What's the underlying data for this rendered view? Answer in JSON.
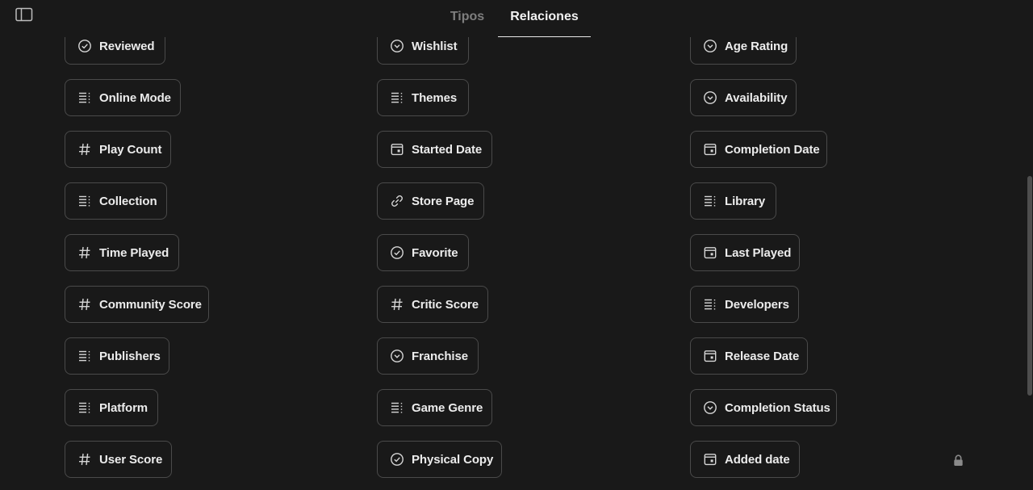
{
  "tabs": [
    {
      "label": "Tipos",
      "active": false
    },
    {
      "label": "Relaciones",
      "active": true
    }
  ],
  "columns": [
    [
      {
        "label": "Reviewed",
        "icon": "circle-check-icon"
      },
      {
        "label": "Online Mode",
        "icon": "list-icon"
      },
      {
        "label": "Play Count",
        "icon": "hash-icon"
      },
      {
        "label": "Collection",
        "icon": "list-icon"
      },
      {
        "label": "Time Played",
        "icon": "hash-icon"
      },
      {
        "label": "Community Score",
        "icon": "hash-icon"
      },
      {
        "label": "Publishers",
        "icon": "list-icon"
      },
      {
        "label": "Platform",
        "icon": "list-icon"
      },
      {
        "label": "User Score",
        "icon": "hash-icon"
      }
    ],
    [
      {
        "label": "Wishlist",
        "icon": "circle-chevron-down-icon"
      },
      {
        "label": "Themes",
        "icon": "list-icon"
      },
      {
        "label": "Started Date",
        "icon": "calendar-icon"
      },
      {
        "label": "Store Page",
        "icon": "link-icon"
      },
      {
        "label": "Favorite",
        "icon": "circle-check-icon"
      },
      {
        "label": "Critic Score",
        "icon": "hash-icon"
      },
      {
        "label": "Franchise",
        "icon": "circle-chevron-down-icon"
      },
      {
        "label": "Game Genre",
        "icon": "list-icon"
      },
      {
        "label": "Physical Copy",
        "icon": "circle-check-icon"
      }
    ],
    [
      {
        "label": "Age Rating",
        "icon": "circle-chevron-down-icon"
      },
      {
        "label": "Availability",
        "icon": "circle-chevron-down-icon"
      },
      {
        "label": "Completion Date",
        "icon": "calendar-icon"
      },
      {
        "label": "Library",
        "icon": "list-icon"
      },
      {
        "label": "Last Played",
        "icon": "calendar-icon"
      },
      {
        "label": "Developers",
        "icon": "list-icon"
      },
      {
        "label": "Release Date",
        "icon": "calendar-icon"
      },
      {
        "label": "Completion Status",
        "icon": "circle-chevron-down-icon"
      },
      {
        "label": "Added date",
        "icon": "calendar-icon"
      }
    ]
  ],
  "icons": {
    "sidebar_toggle": "sidebar-toggle-icon",
    "lock": "lock-icon"
  },
  "colors": {
    "background": "#191919",
    "chip_border": "#4a4a4a",
    "text": "#ececec",
    "muted_tab": "#7e7e7e"
  }
}
